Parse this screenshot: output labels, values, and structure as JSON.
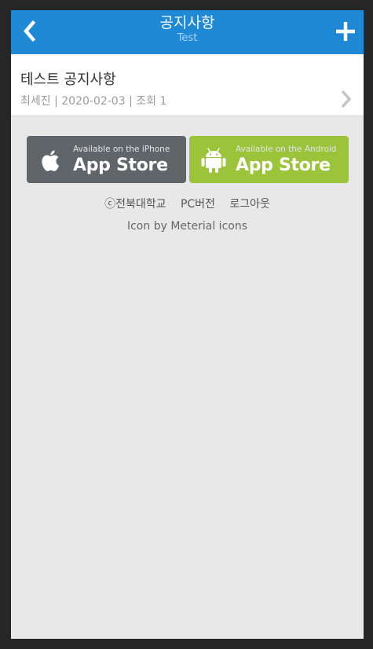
{
  "header": {
    "title": "공지사항",
    "subtitle": "Test",
    "background": "#1f89d5",
    "back_icon": "chevron-left-icon",
    "add_icon": "plus-icon"
  },
  "notices": [
    {
      "title": "테스트 공지사항",
      "meta": "최세진 | 2020-02-03 | 조회 1"
    }
  ],
  "store_buttons": {
    "ios": {
      "small": "Available on the iPhone",
      "big": "App Store",
      "icon": "apple-icon",
      "color": "#5f6569"
    },
    "android": {
      "small": "Available on the Android",
      "big": "App Store",
      "icon": "android-icon",
      "color": "#9bc43b"
    }
  },
  "footer": {
    "links": [
      "ⓒ전북대학교",
      "PC버전",
      "로그아웃"
    ],
    "credit": "Icon by Meterial icons"
  }
}
